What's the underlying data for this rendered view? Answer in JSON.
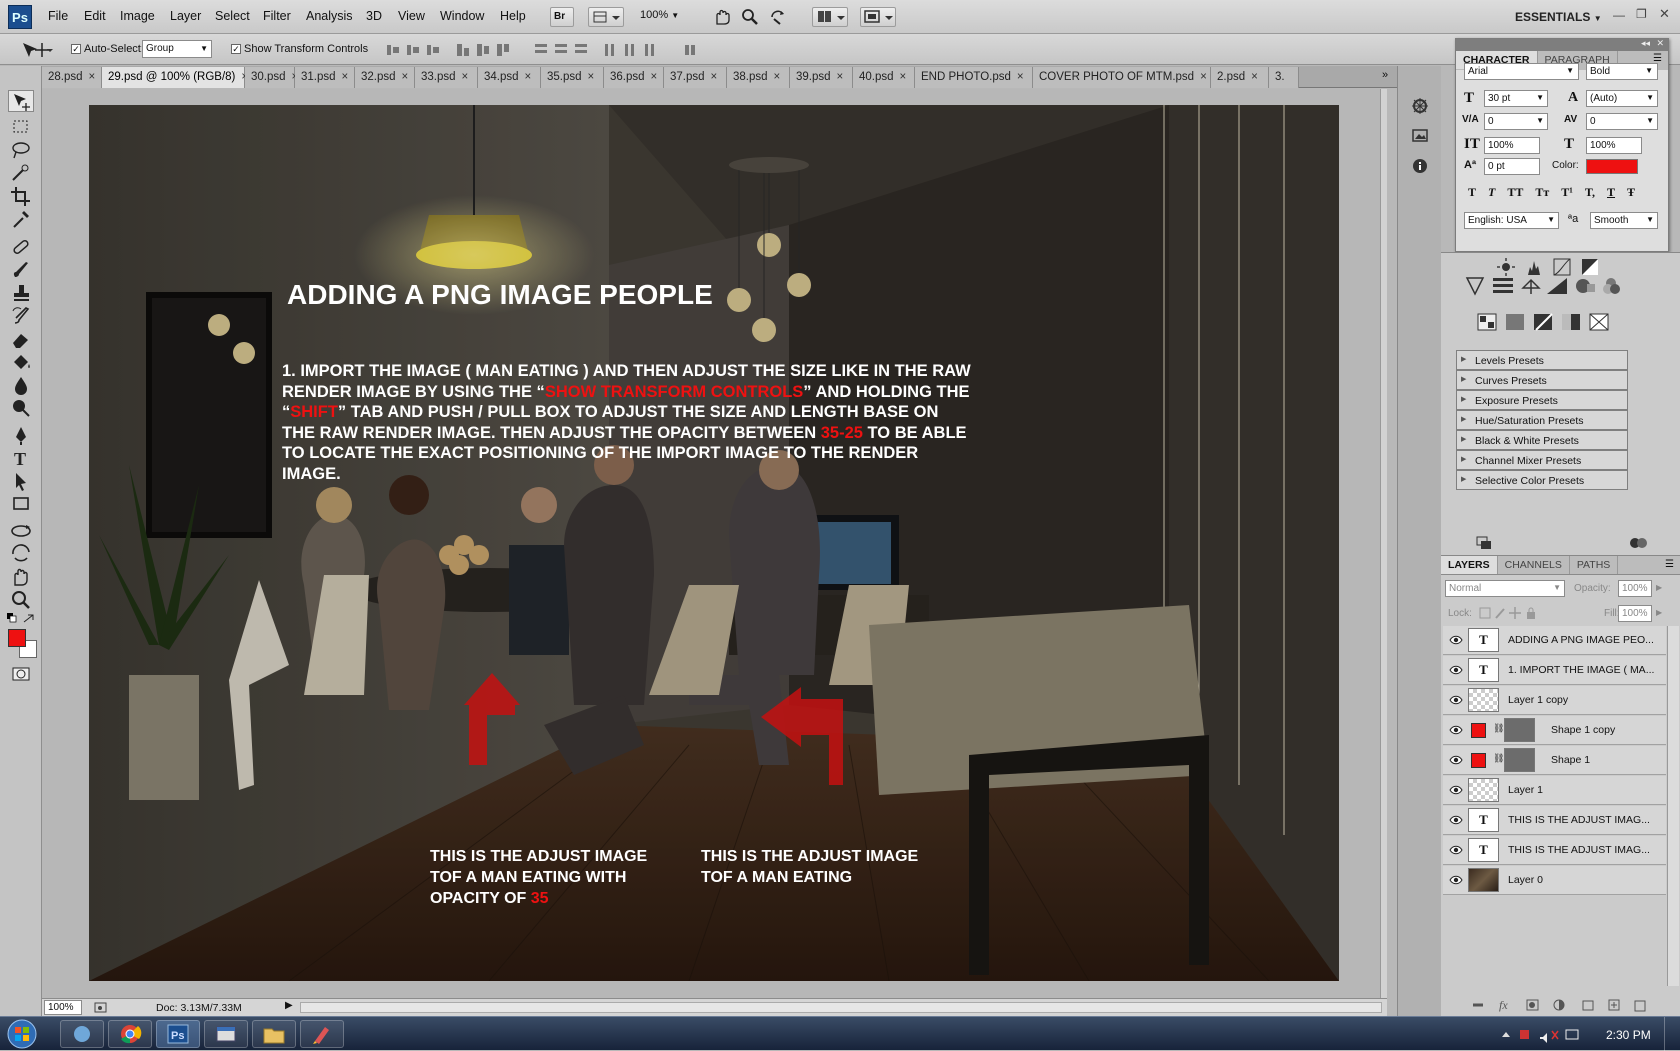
{
  "app": {
    "logo": "Ps"
  },
  "menu": [
    "File",
    "Edit",
    "Image",
    "Layer",
    "Select",
    "Filter",
    "Analysis",
    "3D",
    "View",
    "Window",
    "Help"
  ],
  "appbar": {
    "br_label": "Br",
    "zoom": "100%",
    "workspace": "ESSENTIALS"
  },
  "options": {
    "auto_select_label": "Auto-Select:",
    "auto_select_value": "Group",
    "transform_label": "Show Transform Controls"
  },
  "tabs": [
    "28.psd",
    "29.psd @ 100% (RGB/8)",
    "30.psd",
    "31.psd",
    "32.psd",
    "33.psd",
    "34.psd",
    "35.psd",
    "36.psd",
    "37.psd",
    "38.psd",
    "39.psd",
    "40.psd",
    "END PHOTO.psd",
    "COVER PHOTO OF MTM.psd",
    "2.psd",
    "3."
  ],
  "canvas": {
    "title": "ADDING A PNG IMAGE PEOPLE",
    "para": {
      "l1": "1. IMPORT THE IMAGE ( MAN EATING ) AND THEN ADJUST THE SIZE LIKE IN THE RAW",
      "l2a": "RENDER IMAGE BY USING THE “",
      "l2b": "SHOW TRANSFORM CONTROLS",
      "l2c": "” AND HOLDING THE",
      "l3a": "“",
      "l3b": "SHIFT",
      "l3c": "” TAB AND PUSH / PULL BOX TO ADJUST THE SIZE AND LENGTH BASE ON",
      "l4a": "THE RAW RENDER IMAGE. THEN ADJUST THE OPACITY BETWEEN ",
      "l4b": "35-25",
      "l4c": " TO BE ABLE",
      "l5": "TO LOCATE THE EXACT POSITIONING OF THE IMPORT IMAGE TO THE RENDER",
      "l6": "IMAGE."
    },
    "cap1": {
      "l1": "THIS IS THE ADJUST IMAGE",
      "l2": "TOF A MAN EATING WITH",
      "l3a": "OPACITY OF ",
      "l3b": "35"
    },
    "cap2": {
      "l1": "THIS IS THE ADJUST IMAGE",
      "l2": "TOF A MAN EATING"
    }
  },
  "status": {
    "zoom": "100%",
    "doc": "Doc: 3.13M/7.33M"
  },
  "character": {
    "tabs": [
      "CHARACTER",
      "PARAGRAPH"
    ],
    "font": "Arial",
    "style": "Bold",
    "size": "30 pt",
    "leading": "(Auto)",
    "kerning": "0",
    "tracking": "0",
    "vscale": "100%",
    "hscale": "100%",
    "baseline": "0 pt",
    "color_label": "Color:",
    "color": "#ee1111",
    "styles": [
      "T",
      "T",
      "TT",
      "Tт",
      "T¹",
      "T,",
      "T",
      "Ŧ"
    ],
    "language": "English: USA",
    "aa_icon": "ªa",
    "antialias": "Smooth"
  },
  "adjustments": {
    "presets": [
      "Levels Presets",
      "Curves Presets",
      "Exposure Presets",
      "Hue/Saturation Presets",
      "Black & White Presets",
      "Channel Mixer Presets",
      "Selective Color Presets"
    ]
  },
  "layers": {
    "tabs": [
      "LAYERS",
      "CHANNELS",
      "PATHS"
    ],
    "blend": "Normal",
    "opacity_label": "Opacity:",
    "opacity": "100%",
    "lock_label": "Lock:",
    "fill_label": "Fill:",
    "fill": "100%",
    "items": [
      {
        "name": "ADDING A PNG IMAGE PEO...",
        "kind": "text",
        "thumb": "T"
      },
      {
        "name": "1. IMPORT THE IMAGE ( MA...",
        "kind": "text",
        "thumb": "T"
      },
      {
        "name": "Layer 1 copy",
        "kind": "pixel",
        "thumb": ""
      },
      {
        "name": "Shape 1 copy",
        "kind": "shape",
        "thumb": ""
      },
      {
        "name": "Shape 1",
        "kind": "shape",
        "thumb": ""
      },
      {
        "name": "Layer 1",
        "kind": "pixel",
        "thumb": ""
      },
      {
        "name": "THIS IS THE ADJUST IMAG...",
        "kind": "text",
        "thumb": "T"
      },
      {
        "name": "THIS IS THE ADJUST IMAG...",
        "kind": "text",
        "thumb": "T"
      },
      {
        "name": "Layer 0",
        "kind": "photo",
        "thumb": ""
      }
    ]
  },
  "taskbar": {
    "clock": "2:30 PM"
  },
  "colors": {
    "accent_red": "#ee1111",
    "ps_blue": "#1b4e8f"
  }
}
